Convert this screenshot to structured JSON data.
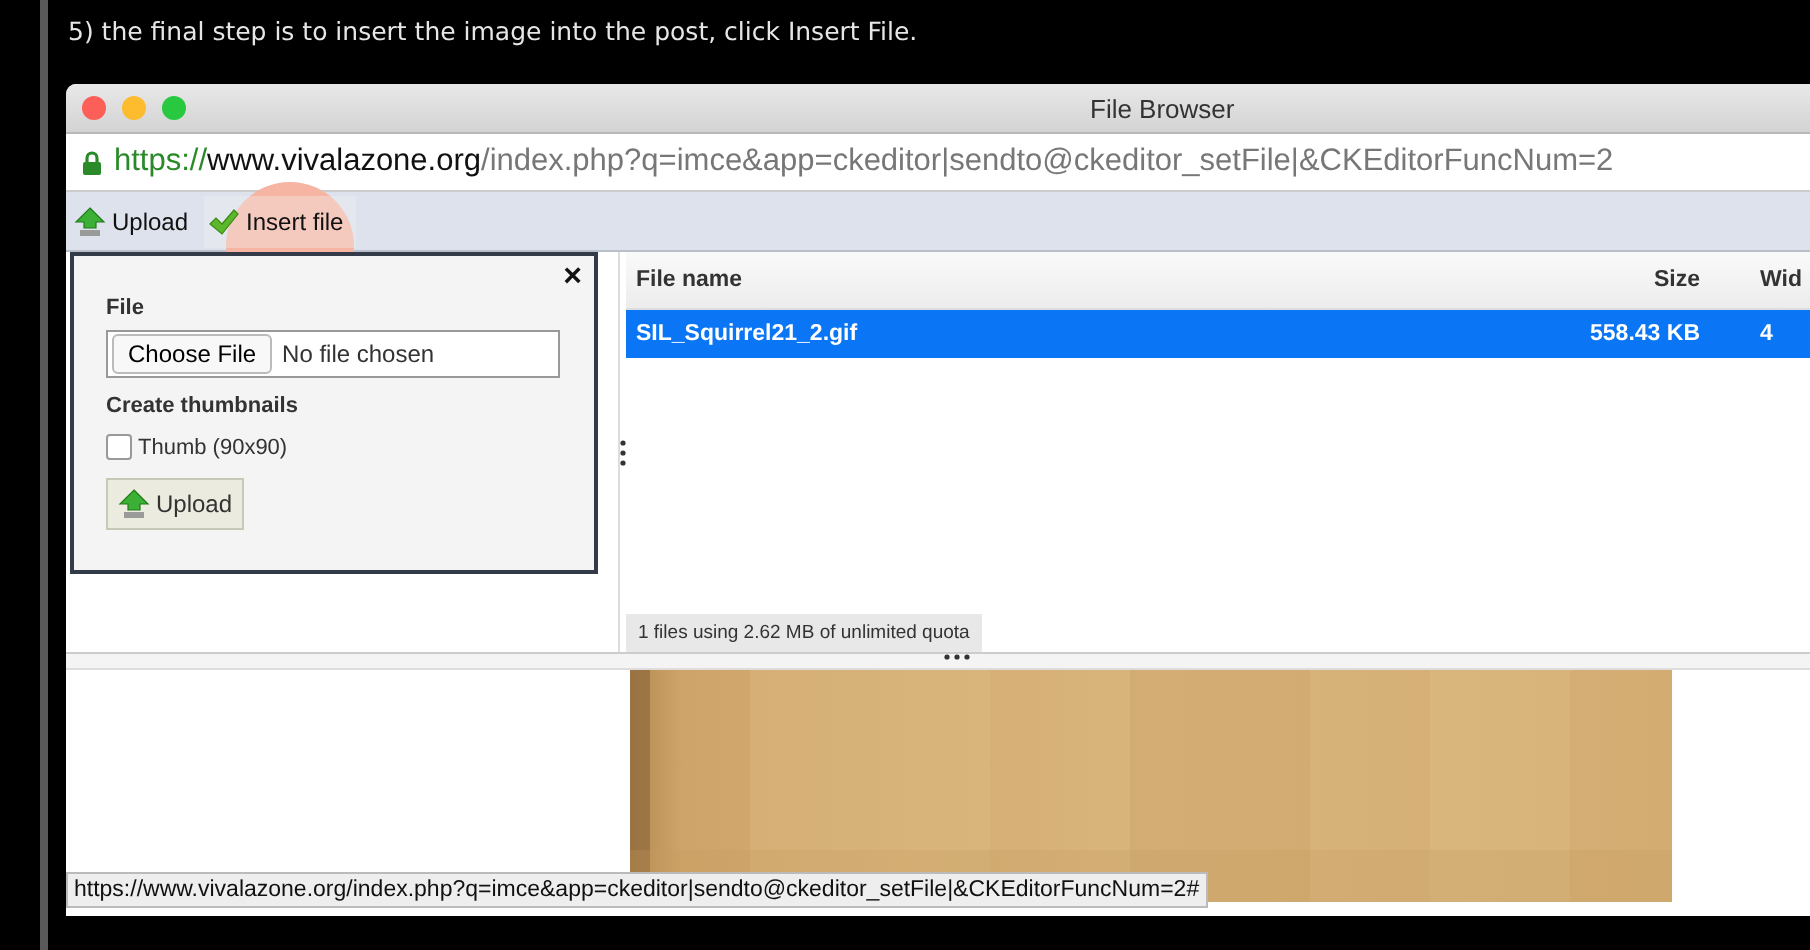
{
  "caption": "5) the final step is to insert the image into the post, click Insert File.",
  "window": {
    "title": "File Browser"
  },
  "address_bar": {
    "scheme": "https://",
    "host": "www.vivalazone.org",
    "path": "/index.php?q=imce&app=ckeditor|sendto@ckeditor_setFile|&CKEditorFuncNum=2"
  },
  "toolbar": [
    {
      "label": "Upload",
      "kind": "upload",
      "highlighted": false
    },
    {
      "label": "Insert file",
      "kind": "insert",
      "highlighted": true
    }
  ],
  "upload_form": {
    "close": "×",
    "file_label": "File",
    "choose_button": "Choose File",
    "file_status": "No file chosen",
    "thumbnails_label": "Create thumbnails",
    "options": [
      {
        "label": "Thumb (90x90)",
        "checked": false
      }
    ],
    "upload_button": "Upload"
  },
  "file_list": {
    "columns": [
      "File name",
      "Size",
      "Wid"
    ],
    "rows": [
      {
        "cells": [
          "SIL_Squirrel21_2.gif",
          "558.43 KB",
          "4"
        ],
        "selected": true
      }
    ],
    "status": "1 files using 2.62 MB of unlimited quota"
  },
  "status_url": "https://www.vivalazone.org/index.php?q=imce&app=ckeditor|sendto@ckeditor_setFile|&CKEditorFuncNum=2#"
}
